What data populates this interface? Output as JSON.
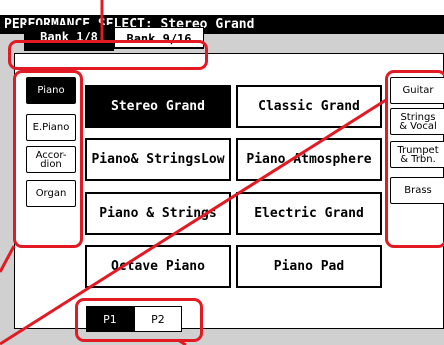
{
  "title": "PERFORMANCE SELECT: Stereo Grand",
  "bank_tabs": [
    {
      "label": "Bank 1/8",
      "selected": true
    },
    {
      "label": "Bank 9/16",
      "selected": false
    }
  ],
  "left_categories": [
    {
      "label": "Piano",
      "selected": true
    },
    {
      "label": "E.Piano",
      "selected": false
    },
    {
      "label": "Accor-\ndion",
      "selected": false
    },
    {
      "label": "Organ",
      "selected": false
    }
  ],
  "right_categories": [
    {
      "label": "Guitar"
    },
    {
      "label": "Strings\n& Vocal"
    },
    {
      "label": "Trumpet\n& Trbn."
    },
    {
      "label": "Brass"
    }
  ],
  "performances": [
    {
      "label": "Stereo Grand",
      "selected": true
    },
    {
      "label": "Classic Grand",
      "selected": false
    },
    {
      "label": "Piano& StringsLow",
      "selected": false
    },
    {
      "label": "Piano Atmosphere",
      "selected": false
    },
    {
      "label": "Piano & Strings",
      "selected": false
    },
    {
      "label": "Electric Grand",
      "selected": false
    },
    {
      "label": "Octave Piano",
      "selected": false
    },
    {
      "label": "Piano Pad",
      "selected": false
    }
  ],
  "pages": [
    {
      "label": "P1",
      "selected": true
    },
    {
      "label": "P2",
      "selected": false
    }
  ],
  "colors": {
    "highlight": "#e21a24",
    "screen": "#d0d0d0"
  }
}
